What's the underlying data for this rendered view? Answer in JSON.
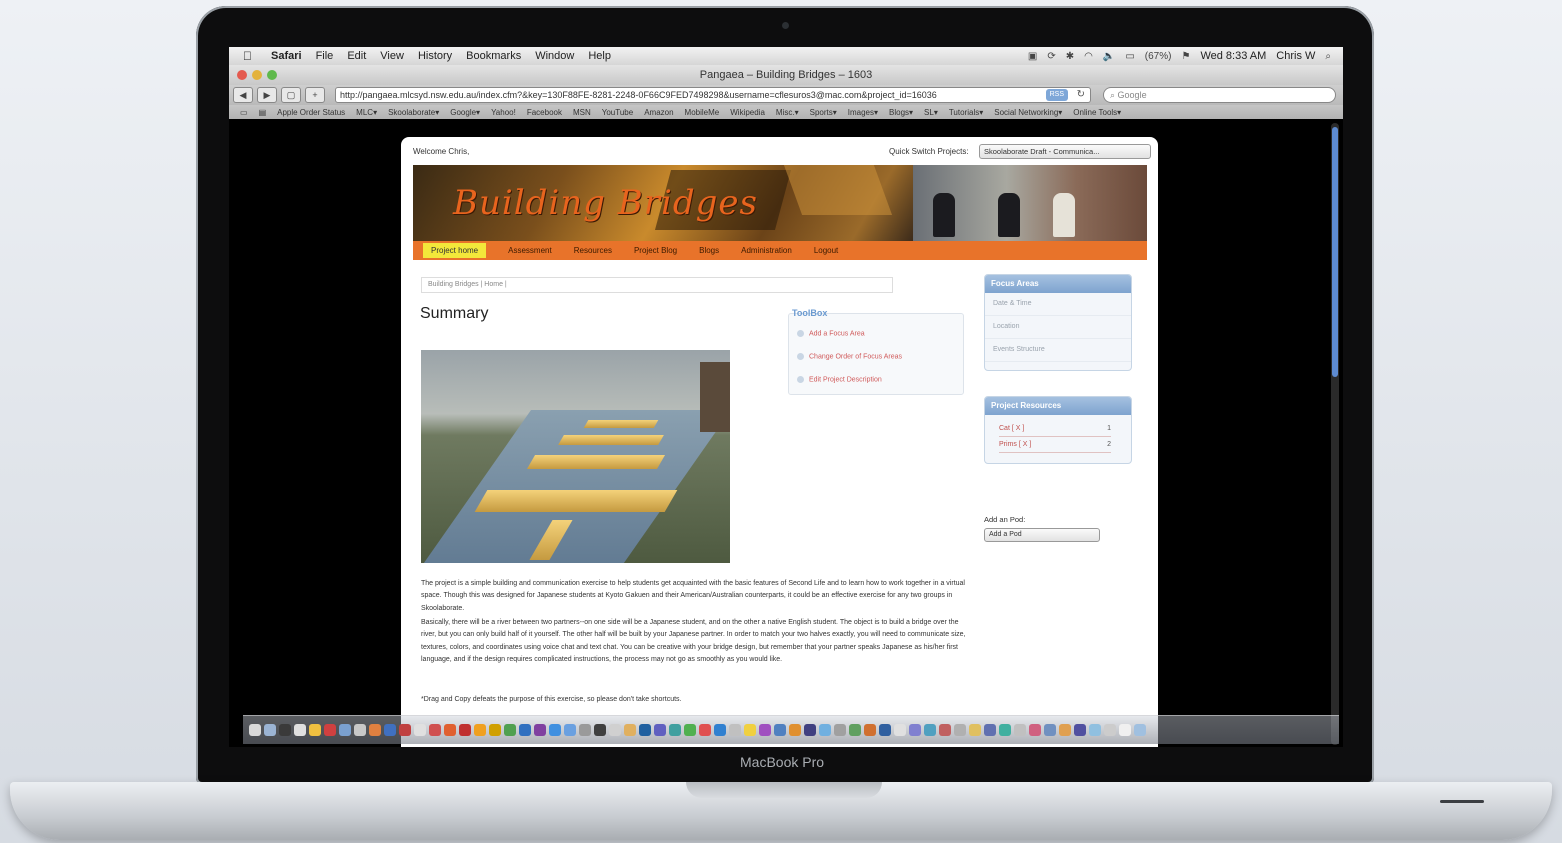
{
  "device": {
    "brand": "MacBook Pro"
  },
  "menubar": {
    "app": "Safari",
    "items": [
      "File",
      "Edit",
      "View",
      "History",
      "Bookmarks",
      "Window",
      "Help"
    ],
    "battery": "(67%)",
    "clock": "Wed 8:33 AM",
    "user": "Chris W"
  },
  "window": {
    "title": "Pangaea – Building Bridges – 1603"
  },
  "toolbar": {
    "back": "◀",
    "forward": "▶",
    "url": "http://pangaea.mlcsyd.nsw.edu.au/index.cfm?&key=130F88FE-8281-2248-0F66C9FED7498298&username=cflesuros3@mac.com&project_id=16036",
    "rss": "RSS",
    "search_placeholder": "Google"
  },
  "bookmarks": [
    "Apple Order Status",
    "MLC▾",
    "Skoolaborate▾",
    "Google▾",
    "Yahoo!",
    "Facebook",
    "MSN",
    "YouTube",
    "Amazon",
    "MobileMe",
    "Wikipedia",
    "Misc.▾",
    "Sports▾",
    "Images▾",
    "Blogs▾",
    "SL▾",
    "Tutorials▾",
    "Social Networking▾",
    "Online Tools▾"
  ],
  "page": {
    "welcome": "Welcome Chris,",
    "quick_switch_label": "Quick Switch Projects:",
    "quick_switch_value": "Skoolaborate Draft - Communica...",
    "banner_title": "Building Bridges",
    "nav": [
      "Project home",
      "Assessment",
      "Resources",
      "Project Blog",
      "Blogs",
      "Administration",
      "Logout"
    ],
    "breadcrumb": "Building Bridges | Home |",
    "summary_title": "Summary",
    "toolbox": {
      "title": "ToolBox",
      "items": [
        "Add a Focus Area",
        "Change Order of Focus Areas",
        "Edit Project Description"
      ]
    },
    "focus_areas": {
      "title": "Focus Areas",
      "items": [
        "Date & Time",
        "Location",
        "Events Structure"
      ]
    },
    "project_resources": {
      "title": "Project Resources",
      "rows": [
        {
          "label": "Cat [ X ]",
          "count": "1"
        },
        {
          "label": "Prims [ X ]",
          "count": "2"
        }
      ]
    },
    "add_pod_label": "Add an Pod:",
    "add_pod_value": "Add a Pod",
    "paragraphs": [
      "The project is a simple building and communication exercise to help students get acquainted with the basic features of Second Life and to learn how to work together in a virtual space. Though this was designed for Japanese students at Kyoto Gakuen and their American/Australian counterparts, it could be an effective exercise for any two groups in Skoolaborate.",
      "Basically, there will be a river between two partners--on one side will be a Japanese student, and on the other a native English student. The object is to build a bridge over the river, but you can only build half of it yourself. The other half will be built by your Japanese partner. In order to match your two halves exactly, you will need to communicate size, textures, colors, and coordinates using voice chat and text chat. You can be creative with your bridge design, but remember that your partner speaks Japanese as his/her first language, and if the design requires complicated instructions, the process may not go as smoothly as you would like.",
      "*Drag and Copy defeats the purpose of this exercise, so please don't take shortcuts."
    ]
  },
  "dock_colors": [
    "#d9d9d9",
    "#9bb4d4",
    "#3a3a3a",
    "#e0e0e0",
    "#f0c040",
    "#d04040",
    "#7aa0d0",
    "#c8c8c8",
    "#e08040",
    "#4070c0",
    "#c04040",
    "#e0e0e0",
    "#d05050",
    "#e06030",
    "#c03030",
    "#f0a020",
    "#d0a000",
    "#50a050",
    "#3070c0",
    "#8040a0",
    "#4090e0",
    "#6aa0e0",
    "#9a9a9a",
    "#404040",
    "#d0d0d0",
    "#e0b060",
    "#2060a0",
    "#6060c0",
    "#40a0a0",
    "#50b050",
    "#e05050",
    "#3080d0",
    "#c0c0c0",
    "#f0d040",
    "#a050c0",
    "#5080c0",
    "#e09030",
    "#404080",
    "#70b0e0",
    "#a0a0a0",
    "#60a060",
    "#d07030",
    "#3060a0",
    "#e0e0e0",
    "#8080d0",
    "#50a0c0",
    "#c06060",
    "#b0b0b0",
    "#e0c060",
    "#6070b0",
    "#40b0a0",
    "#c0c0c0",
    "#d06080",
    "#7090c0",
    "#e0a050",
    "#5050a0",
    "#90c0e0",
    "#cccccc",
    "#f0f0f0",
    "#a0c0e0"
  ]
}
